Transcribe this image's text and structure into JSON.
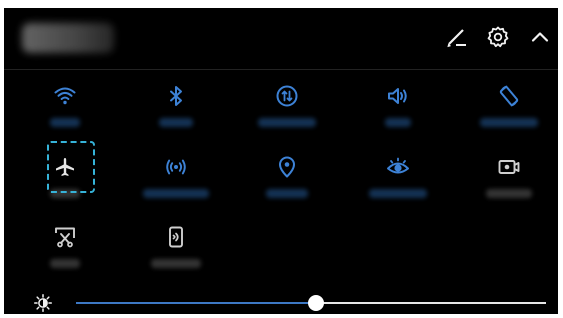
{
  "colors": {
    "background": "#000000",
    "active_icon": "#3d82d6",
    "inactive_icon": "#cfcfcf",
    "highlight_border": "#36b3d8",
    "slider_fill": "#3d78c4",
    "slider_track": "#e6e6e6"
  },
  "topbar": {
    "icons": [
      "edit-icon",
      "settings-icon",
      "chevron-up-icon"
    ]
  },
  "toggles": [
    {
      "name": "wifi",
      "icon": "wifi-icon",
      "active": true
    },
    {
      "name": "bluetooth",
      "icon": "bluetooth-icon",
      "active": true
    },
    {
      "name": "mobile-data",
      "icon": "mobile-data-icon",
      "active": true
    },
    {
      "name": "sound",
      "icon": "sound-icon",
      "active": true
    },
    {
      "name": "auto-rotate",
      "icon": "auto-rotate-icon",
      "active": true
    },
    {
      "name": "airplane-mode",
      "icon": "airplane-icon",
      "active": false,
      "highlighted": true
    },
    {
      "name": "hotspot",
      "icon": "hotspot-icon",
      "active": true
    },
    {
      "name": "location",
      "icon": "location-icon",
      "active": true
    },
    {
      "name": "eye-comfort",
      "icon": "eye-comfort-icon",
      "active": true
    },
    {
      "name": "screen-recorder",
      "icon": "screen-recorder-icon",
      "active": false
    },
    {
      "name": "screenshot",
      "icon": "screenshot-icon",
      "active": false
    },
    {
      "name": "huawei-share",
      "icon": "huawei-share-icon",
      "active": false
    }
  ],
  "brightness": {
    "icon": "brightness-icon",
    "level": 0.51
  }
}
